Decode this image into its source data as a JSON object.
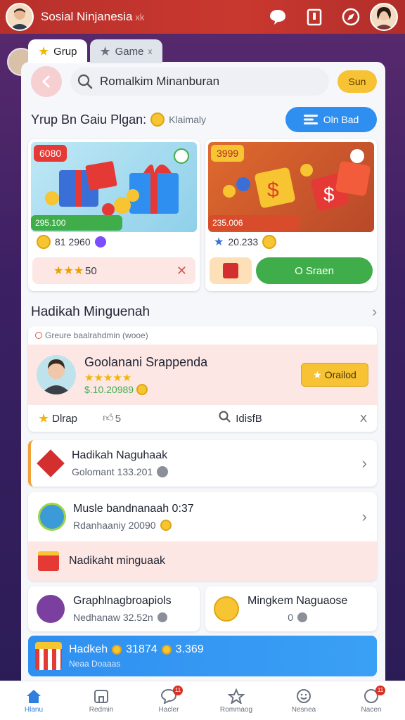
{
  "appbar": {
    "title": "Sosial Ninjanesia",
    "title_suffix": "xk"
  },
  "tabs": [
    {
      "label": "Grup",
      "active": true
    },
    {
      "label": "Game",
      "suffix": "x",
      "active": false
    }
  ],
  "search": {
    "value": "Romalkim Minanburan",
    "button_label": "Sun"
  },
  "group": {
    "title": "Yrup Bn Gaiu Plgan:",
    "subtitle": "Klaimaly",
    "button_label": "Oln Bad"
  },
  "products": [
    {
      "tag": "6080",
      "price_bar": "295.100",
      "meta": "81 2960",
      "action_label": "50",
      "action_close": "✕"
    },
    {
      "tag": "3999",
      "price_bar": "235.006",
      "meta": "20.233",
      "action_label": "O Sraen"
    }
  ],
  "section": {
    "title": "Hadikah Minguenah"
  },
  "feature": {
    "caption": "Greure baalrahdmin (wooe)",
    "name": "Goolanani Srappenda",
    "stars": "★★★★★",
    "amount": "$.10.20989",
    "button_label": "Orailod",
    "foot": [
      "Dlrap",
      "5",
      "IdisfB",
      "X"
    ]
  },
  "rows": [
    {
      "title": "Hadikah Naguhaak",
      "sub": "Golomant 133.201"
    },
    {
      "title": "Musle bandnanaah 0:37",
      "sub": "Rdanhaaniy 20090"
    },
    {
      "title": "Nadikaht minguaak"
    }
  ],
  "halves": [
    {
      "title": "Graphlnagbroapiols",
      "sub": "Nedhanaw 32.52n"
    },
    {
      "title": "Mingkem Naguaose",
      "sub": "0"
    }
  ],
  "blue_bar": {
    "title": "Hadkeh",
    "value1": "31874",
    "value2": "3.369",
    "sub": "Neaa Doaaas"
  },
  "nav": [
    {
      "label": "Hlanu",
      "active": true
    },
    {
      "label": "Redmin"
    },
    {
      "label": "Hacler",
      "badge": "11"
    },
    {
      "label": "Rommaog"
    },
    {
      "label": "Nesnea"
    },
    {
      "label": "Nacen",
      "badge": "11"
    }
  ],
  "colors": {
    "appbar": "#c9382f",
    "accent_blue": "#2f8ff0",
    "accent_green": "#3fae4a",
    "accent_yellow": "#f7c233",
    "pink": "#fde7e5"
  }
}
